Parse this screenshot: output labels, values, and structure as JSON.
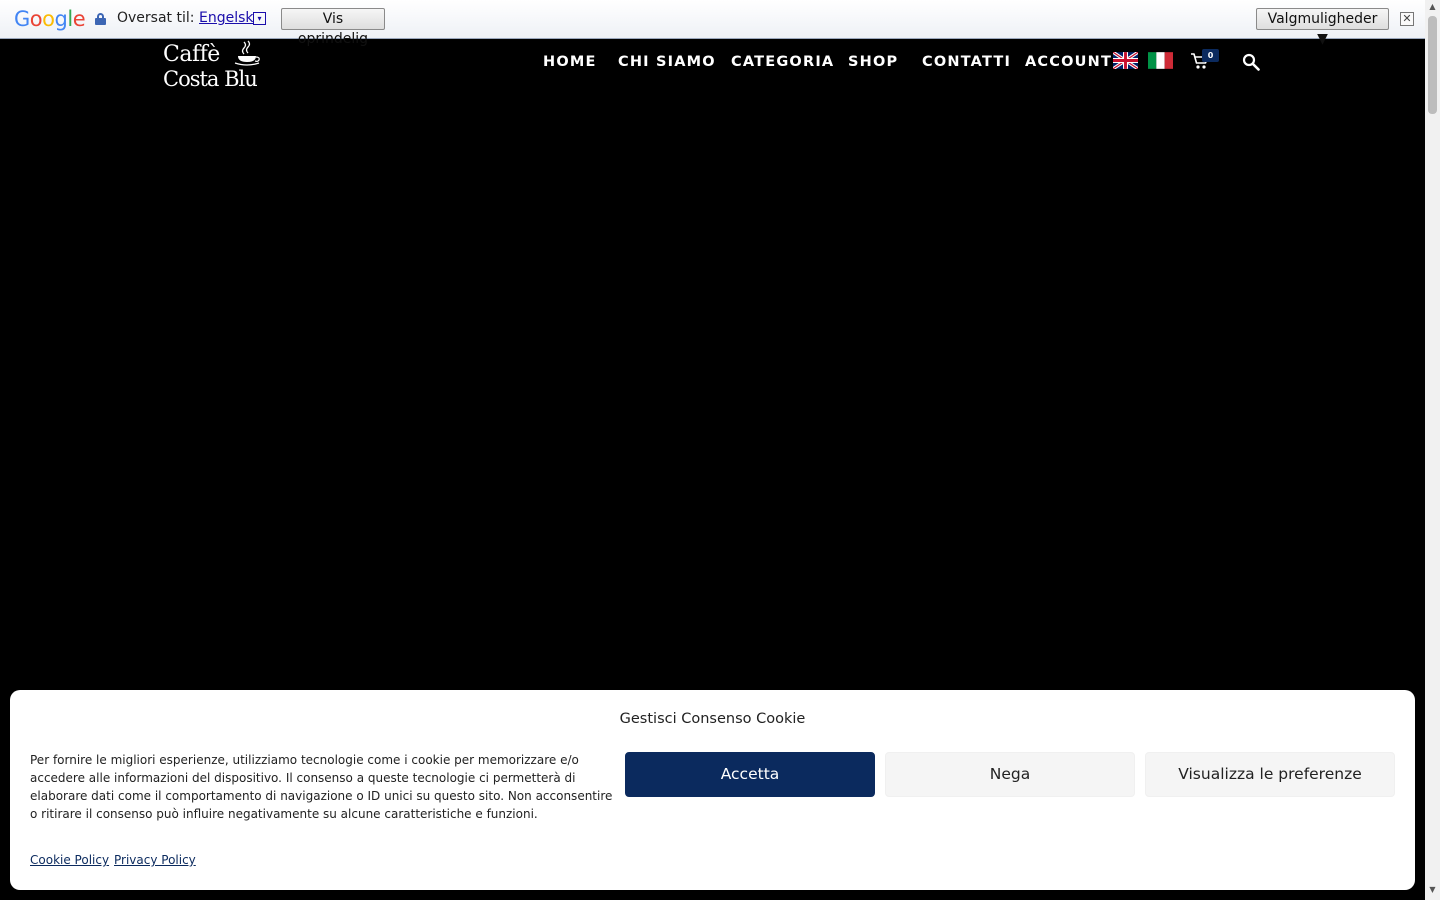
{
  "translate_bar": {
    "logo": [
      "G",
      "o",
      "o",
      "g",
      "l",
      "e"
    ],
    "translated_to_label": "Oversat til:",
    "language": "Engelsk",
    "language_dropdown_arrow": "▾",
    "show_original_label": "Vis oprindelig",
    "options_label": "Valgmuligheder ▼",
    "close_label": "✕",
    "icons": {
      "lock": "lock-icon"
    }
  },
  "site": {
    "logo_line1": "Caffè",
    "logo_line2": "Costa Blu",
    "nav": [
      "HOME",
      "CHI SIAMO",
      "CATEGORIA",
      "SHOP",
      "CONTATTI",
      "ACCOUNT"
    ],
    "cart_count": "0",
    "icons": {
      "flag_en": "uk-flag-icon",
      "flag_it": "italy-flag-icon",
      "cart": "cart-icon",
      "search": "search-icon"
    },
    "colors": {
      "accent": "#0b2a5e",
      "background": "#000000"
    }
  },
  "cookie_banner": {
    "title": "Gestisci Consenso Cookie",
    "text": "Per fornire le migliori esperienze, utilizziamo tecnologie come i cookie per memorizzare e/o accedere alle informazioni del dispositivo. Il consenso a queste tecnologie ci permetterà di elaborare dati come il comportamento di navigazione o ID unici su questo sito. Non acconsentire o ritirare il consenso può influire negativamente su alcune caratteristiche e funzioni.",
    "accept_label": "Accetta",
    "deny_label": "Nega",
    "preferences_label": "Visualizza le preferenze",
    "cookie_policy_link": "Cookie Policy",
    "privacy_policy_link": "Privacy Policy"
  }
}
